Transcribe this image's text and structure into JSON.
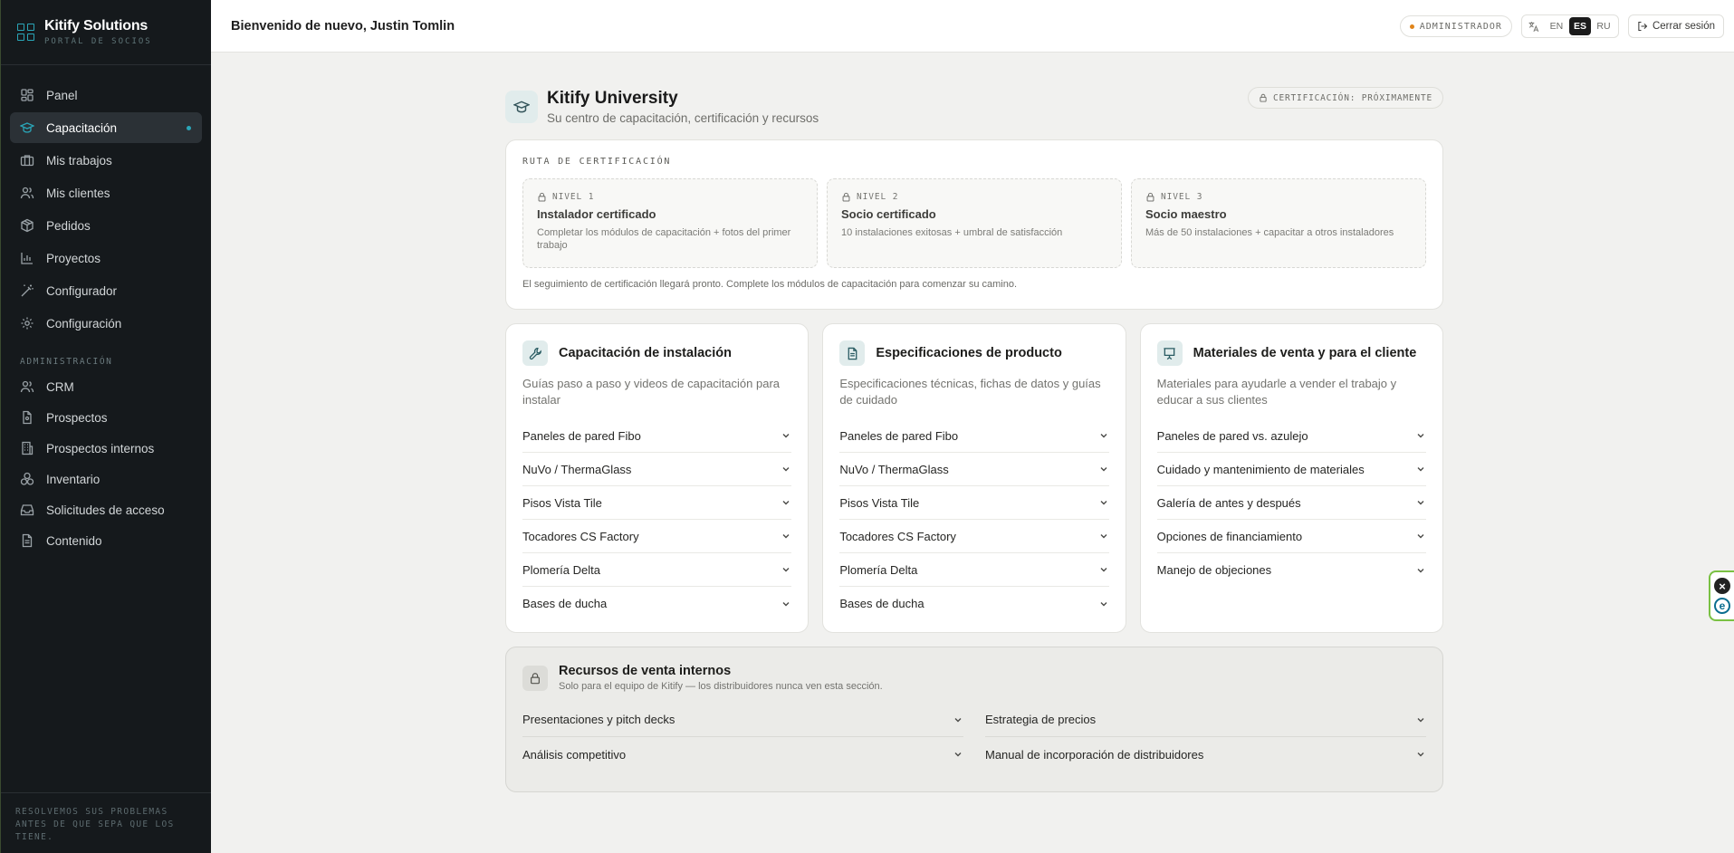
{
  "brand": {
    "name": "Kitify Solutions",
    "subtitle": "PORTAL DE SOCIOS",
    "accent": "#2aa6b8"
  },
  "sidebar": {
    "items": [
      {
        "label": "Panel",
        "icon": "grid-icon"
      },
      {
        "label": "Capacitación",
        "icon": "graduation-cap-icon",
        "active": true
      },
      {
        "label": "Mis trabajos",
        "icon": "briefcase-icon"
      },
      {
        "label": "Mis clientes",
        "icon": "users-icon"
      },
      {
        "label": "Pedidos",
        "icon": "package-icon"
      },
      {
        "label": "Proyectos",
        "icon": "chart-icon"
      },
      {
        "label": "Configurador",
        "icon": "wand-icon"
      },
      {
        "label": "Configuración",
        "icon": "gear-icon"
      }
    ],
    "admin_section": "ADMINISTRACIÓN",
    "admin_items": [
      {
        "label": "CRM",
        "icon": "users-icon"
      },
      {
        "label": "Prospectos",
        "icon": "file-icon"
      },
      {
        "label": "Prospectos internos",
        "icon": "building-icon"
      },
      {
        "label": "Inventario",
        "icon": "boxes-icon"
      },
      {
        "label": "Solicitudes de acceso",
        "icon": "inbox-icon"
      },
      {
        "label": "Contenido",
        "icon": "document-icon"
      }
    ],
    "footer": "RESOLVEMOS SUS PROBLEMAS ANTES DE QUE SEPA QUE LOS TIENE."
  },
  "topbar": {
    "welcome": "Bienvenido de nuevo, Justin Tomlin",
    "role": "ADMINISTRADOR",
    "languages": [
      "EN",
      "ES",
      "RU"
    ],
    "active_language": "ES",
    "logout": "Cerrar sesión"
  },
  "page": {
    "title": "Kitify University",
    "subtitle": "Su centro de capacitación, certificación y recursos",
    "cert_badge": "CERTIFICACIÓN: PRÓXIMAMENTE"
  },
  "certification": {
    "title": "RUTA DE CERTIFICACIÓN",
    "levels": [
      {
        "tag": "NIVEL 1",
        "name": "Instalador certificado",
        "desc": "Completar los módulos de capacitación + fotos del primer trabajo"
      },
      {
        "tag": "NIVEL 2",
        "name": "Socio certificado",
        "desc": "10 instalaciones exitosas + umbral de satisfacción"
      },
      {
        "tag": "NIVEL 3",
        "name": "Socio maestro",
        "desc": "Más de 50 instalaciones + capacitar a otros instaladores"
      }
    ],
    "note": "El seguimiento de certificación llegará pronto. Complete los módulos de capacitación para comenzar su camino."
  },
  "sections": [
    {
      "title": "Capacitación de instalación",
      "desc": "Guías paso a paso y videos de capacitación para instalar",
      "icon": "wrench-icon",
      "items": [
        "Paneles de pared Fibo",
        "NuVo / ThermaGlass",
        "Pisos Vista Tile",
        "Tocadores CS Factory",
        "Plomería Delta",
        "Bases de ducha"
      ]
    },
    {
      "title": "Especificaciones de producto",
      "desc": "Especificaciones técnicas, fichas de datos y guías de cuidado",
      "icon": "document-icon",
      "items": [
        "Paneles de pared Fibo",
        "NuVo / ThermaGlass",
        "Pisos Vista Tile",
        "Tocadores CS Factory",
        "Plomería Delta",
        "Bases de ducha"
      ]
    },
    {
      "title": "Materiales de venta y para el cliente",
      "desc": "Materiales para ayudarle a vender el trabajo y educar a sus clientes",
      "icon": "presentation-icon",
      "items": [
        "Paneles de pared vs. azulejo",
        "Cuidado y mantenimiento de materiales",
        "Galería de antes y después",
        "Opciones de financiamiento",
        "Manejo de objeciones"
      ]
    }
  ],
  "internal": {
    "title": "Recursos de venta internos",
    "subtitle": "Solo para el equipo de Kitify — los distribuidores nunca ven esta sección.",
    "items": [
      "Presentaciones y pitch decks",
      "Estrategia de precios",
      "Análisis competitivo",
      "Manual de incorporación de distribuidores"
    ]
  }
}
